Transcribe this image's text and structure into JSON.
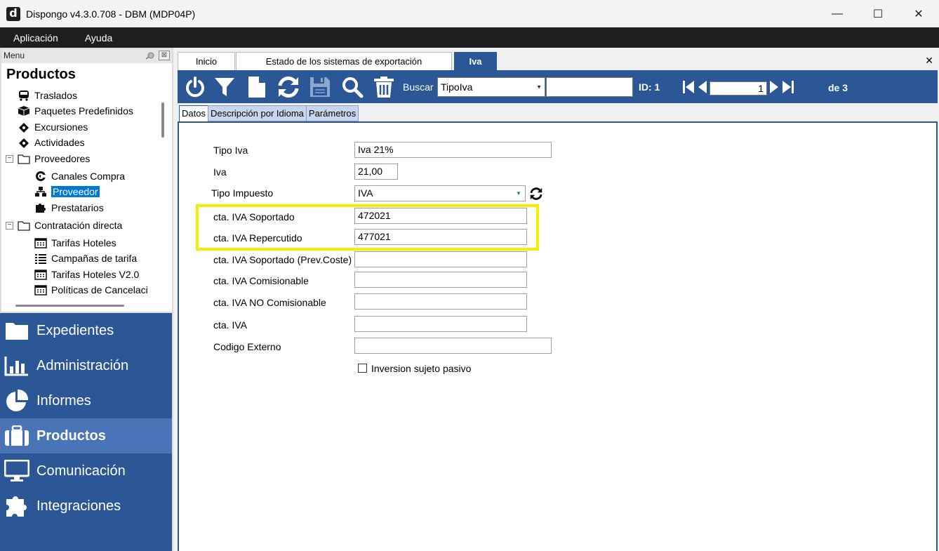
{
  "window": {
    "title": "Dispongo v4.3.0.708 - DBM (MDP04P)",
    "app_icon_letter": "d",
    "minimize": "—",
    "maximize": "☐",
    "close": "✕"
  },
  "menubar": [
    "Aplicación",
    "Ayuda"
  ],
  "left_panel": {
    "menu_label": "Menu",
    "close_glyph": "⊠",
    "section_title": "Productos",
    "tree": [
      {
        "label": "Traslados",
        "icon": "bus-icon"
      },
      {
        "label": "Paquetes Predefinidos",
        "icon": "box-icon"
      },
      {
        "label": "Excursiones",
        "icon": "ticket-icon"
      },
      {
        "label": "Actividades",
        "icon": "ticket-icon"
      },
      {
        "label": "Proveedores",
        "icon": "folder-icon"
      },
      {
        "label": "Canales Compra",
        "icon": "channel-icon"
      },
      {
        "label": "Proveedor",
        "icon": "sitemap-icon"
      },
      {
        "label": "Prestatarios",
        "icon": "puzzle-icon"
      },
      {
        "label": "Contratación directa",
        "icon": "folder-icon"
      },
      {
        "label": "Tarifas Hoteles",
        "icon": "calendar-icon"
      },
      {
        "label": "Campañas de tarifa",
        "icon": "list-icon"
      },
      {
        "label": "Tarifas Hoteles V2.0",
        "icon": "calendar-icon"
      },
      {
        "label": "Políticas de Cancelaci",
        "icon": "calendar-icon"
      }
    ],
    "collapse_glyph": "−",
    "nav": [
      {
        "label": "Expedientes",
        "icon": "folder-icon"
      },
      {
        "label": "Administración",
        "icon": "bar-chart-icon"
      },
      {
        "label": "Informes",
        "icon": "pie-chart-icon"
      },
      {
        "label": "Productos",
        "icon": "suitcase-icon"
      },
      {
        "label": "Comunicación",
        "icon": "monitor-icon"
      },
      {
        "label": "Integraciones",
        "icon": "puzzle-icon"
      }
    ]
  },
  "doc_tabs": [
    "Inicio",
    "Estado de los sistemas de exportación",
    "Iva"
  ],
  "close_all": "✕",
  "toolbar": {
    "search_label": "Buscar",
    "search_field_value": "TipoIva",
    "id_label": "ID: 1",
    "page_value": "1",
    "of_label": "de 3"
  },
  "sub_tabs": [
    "Datos",
    "Descripción por Idioma",
    "Parámetros"
  ],
  "form": {
    "tipo_iva_label": "Tipo Iva",
    "tipo_iva_value": "Iva 21%",
    "iva_label": "Iva",
    "iva_value": "21,00",
    "tipo_impuesto_label": "Tipo Impuesto",
    "tipo_impuesto_value": "IVA",
    "soportado_label": "cta. IVA Soportado",
    "soportado_value": "472021",
    "repercutido_label": "cta. IVA Repercutido",
    "repercutido_value": "477021",
    "soportado_prev_label": "cta. IVA Soportado (Prev.Coste)",
    "soportado_prev_value": "",
    "comisionable_label": "cta. IVA Comisionable",
    "comisionable_value": "",
    "no_comisionable_label": "cta. IVA NO Comisionable",
    "no_comisionable_value": "",
    "cta_iva_label": "cta. IVA",
    "cta_iva_value": "",
    "codigo_externo_label": "Codigo Externo",
    "codigo_externo_value": "",
    "inversion_label": "Inversion sujeto pasivo"
  },
  "colors": {
    "accent": "#2b5797",
    "nav_active": "#4a74b8",
    "highlight": "#f4ef00",
    "selection": "#0078d7"
  }
}
